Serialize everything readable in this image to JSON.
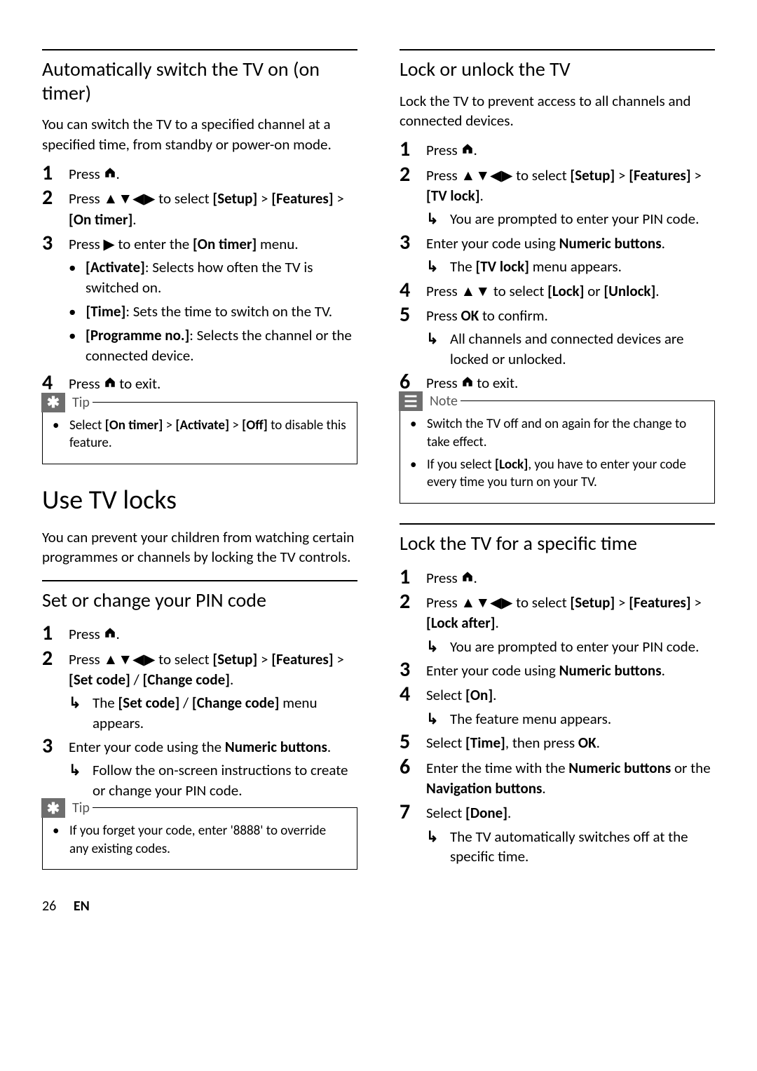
{
  "left": {
    "sec1": {
      "title": "Automatically switch the TV on (on timer)",
      "intro": "You can switch the TV to a specified channel at a specified time, from standby or power-on mode.",
      "s1": "Press ",
      "s1_tail": ".",
      "s2_a": "Press ",
      "s2_b": " to select ",
      "s2_setup": "[Setup]",
      "s2_gt": " > ",
      "s2_feat": "[Features]",
      "s2_gt2": " > ",
      "s2_on": "[On timer]",
      "s2_tail": ".",
      "s3_a": "Press ",
      "s3_b": " to enter the ",
      "s3_on": "[On timer]",
      "s3_tail": " menu.",
      "b1_k": "[Activate]",
      "b1_v": ": Selects how often the TV is switched on.",
      "b2_k": "[Time]",
      "b2_v": ": Sets the time to switch on the TV.",
      "b3_k": "[Programme no.]",
      "b3_v": ": Selects the channel or the connected device.",
      "s4_a": "Press ",
      "s4_b": " to exit.",
      "tip_label": "Tip",
      "tip1_a": "Select ",
      "tip1_b": "[On timer]",
      "tip1_c": " > ",
      "tip1_d": "[Activate]",
      "tip1_e": " > ",
      "tip1_f": "[Off]",
      "tip1_g": " to disable this feature."
    },
    "sec2": {
      "title": "Use TV locks",
      "intro": "You can prevent your children from watching certain programmes or channels by locking the TV controls."
    },
    "sec3": {
      "title": "Set or change your PIN code",
      "s1": "Press ",
      "s1_tail": ".",
      "s2_a": "Press ",
      "s2_b": " to select ",
      "s2_setup": "[Setup]",
      "s2_gt": " > ",
      "s2_feat": "[Features]",
      "s2_gt2": " > ",
      "s2_set": "[Set code]",
      "s2_slash": " / ",
      "s2_chg": "[Change code]",
      "s2_tail": ".",
      "r1_a": "The ",
      "r1_b": "[Set code]",
      "r1_c": " / ",
      "r1_d": "[Change code]",
      "r1_e": " menu appears.",
      "s3_a": "Enter your code using the ",
      "s3_b": "Numeric buttons",
      "s3_tail": ".",
      "r2": "Follow the on-screen instructions to create or change your PIN code.",
      "tip_label": "Tip",
      "tip1": "If you forget your code, enter '8888' to override any existing codes."
    }
  },
  "right": {
    "sec1": {
      "title": "Lock or unlock the TV",
      "intro": "Lock the TV to prevent access to all channels and connected devices.",
      "s1": "Press ",
      "s1_tail": ".",
      "s2_a": "Press ",
      "s2_b": " to select ",
      "s2_setup": "[Setup]",
      "s2_gt": " > ",
      "s2_feat": "[Features]",
      "s2_gt2": " > ",
      "s2_tvlock": "[TV lock]",
      "s2_tail": ".",
      "r1": "You are prompted to enter your PIN code.",
      "s3_a": "Enter your code using ",
      "s3_b": "Numeric buttons",
      "s3_tail": ".",
      "r2_a": "The ",
      "r2_b": "[TV lock]",
      "r2_c": " menu appears.",
      "s4_a": "Press ",
      "s4_b": " to select ",
      "s4_lock": "[Lock]",
      "s4_or": " or ",
      "s4_unlock": "[Unlock]",
      "s4_tail": ".",
      "s5_a": "Press ",
      "s5_b": "OK",
      "s5_tail": " to confirm.",
      "r3": "All channels and connected devices are locked or unlocked.",
      "s6_a": "Press ",
      "s6_b": " to exit.",
      "note_label": "Note",
      "note1": "Switch the TV off and on again for the change to take effect.",
      "note2_a": "If you select ",
      "note2_b": "[Lock]",
      "note2_c": ", you have to enter your code every time you turn on your TV."
    },
    "sec2": {
      "title": "Lock the TV for a specific time",
      "s1": "Press ",
      "s1_tail": ".",
      "s2_a": "Press ",
      "s2_b": " to select ",
      "s2_setup": "[Setup]",
      "s2_gt": " > ",
      "s2_feat": "[Features]",
      "s2_gt2": " > ",
      "s2_lockafter": "[Lock after]",
      "s2_tail": ".",
      "r1": "You are prompted to enter your PIN code.",
      "s3_a": "Enter your code using ",
      "s3_b": "Numeric buttons",
      "s3_tail": ".",
      "s4_a": "Select ",
      "s4_b": "[On]",
      "s4_tail": ".",
      "r2": "The feature menu appears.",
      "s5_a": "Select ",
      "s5_b": "[Time]",
      "s5_c": ", then press ",
      "s5_d": "OK",
      "s5_tail": ".",
      "s6_a": "Enter the time with the ",
      "s6_b": "Numeric buttons",
      "s6_c": " or the ",
      "s6_d": "Navigation buttons",
      "s6_tail": ".",
      "s7_a": "Select ",
      "s7_b": "[Done]",
      "s7_tail": ".",
      "r3": "The TV automatically switches off at the specific time."
    }
  },
  "footer": {
    "page": "26",
    "lang": "EN"
  }
}
